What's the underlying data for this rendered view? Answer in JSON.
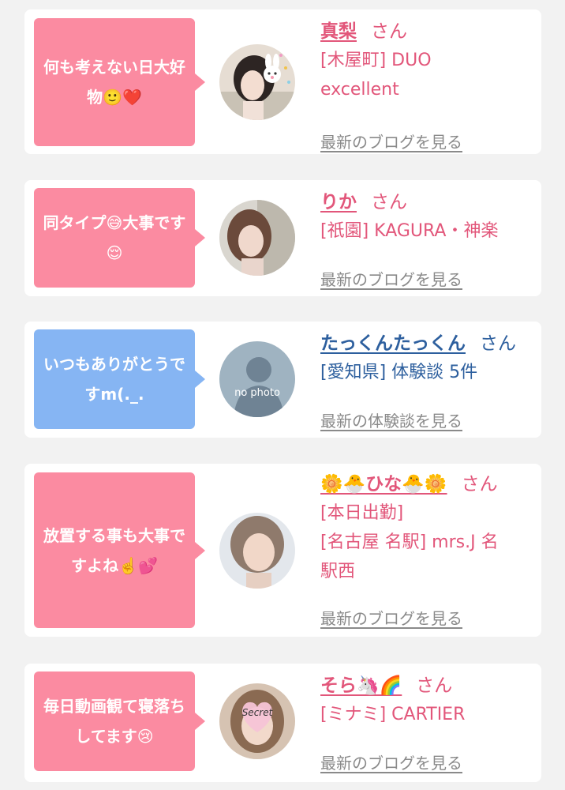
{
  "entries": [
    {
      "comment": "何も考えない日大好物🙂❤️",
      "name": "真梨",
      "honorific": "さん",
      "details": [
        "[木屋町] DUO",
        "excellent"
      ],
      "more_link": "最新のブログを見る",
      "avatar_icon": "rabbit-icon"
    },
    {
      "comment": "同タイプ😅大事です😌",
      "name": "りか",
      "honorific": "さん",
      "details": [
        "[祇園] KAGURA・神楽"
      ],
      "more_link": "最新のブログを見る"
    },
    {
      "comment": "いつもありがとうですm(._.",
      "name": "たっくんたっくん",
      "honorific": "さん",
      "details": [
        "[愛知県] 体験談 5件"
      ],
      "more_link": "最新の体験談を見る",
      "avatar_text": "no photo"
    },
    {
      "comment": "放置する事も大事ですよね☝️💕",
      "name": "🌼🐣ひな🐣🌼",
      "honorific": "さん",
      "details": [
        "[本日出勤]",
        "[名古屋 名駅] mrs.J 名",
        "駅西"
      ],
      "more_link": "最新のブログを見る"
    },
    {
      "comment": "毎日動画観て寝落ちしてます😢",
      "name": "そら🦄🌈",
      "honorific": "さん",
      "details": [
        "[ミナミ] CARTIER"
      ],
      "more_link": "最新のブログを見る",
      "avatar_badge": "Secret"
    }
  ],
  "colors": {
    "pink_bubble": "#fb8ba1",
    "blue_bubble": "#86b5f3",
    "pink_text": "#e2567a",
    "blue_text": "#2d5f9e",
    "link_gray": "#8a8a8a"
  }
}
